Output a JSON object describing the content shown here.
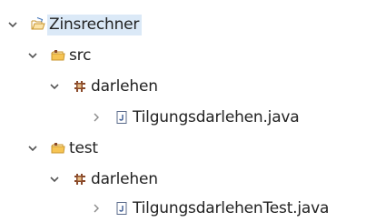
{
  "tree": {
    "project": {
      "label": "Zinsrechner",
      "expanded": true,
      "selected": true,
      "icon": "project-folder-icon"
    },
    "src_folder": {
      "label": "src",
      "expanded": true,
      "icon": "source-folder-icon"
    },
    "src_package": {
      "label": "darlehen",
      "expanded": true,
      "icon": "package-icon"
    },
    "src_file": {
      "label": "Tilgungsdarlehen.java",
      "expanded": false,
      "icon": "java-file-icon"
    },
    "test_folder": {
      "label": "test",
      "expanded": true,
      "icon": "source-folder-icon"
    },
    "test_package": {
      "label": "darlehen",
      "expanded": true,
      "icon": "package-icon"
    },
    "test_file": {
      "label": "TilgungsdarlehenTest.java",
      "expanded": false,
      "icon": "java-file-icon"
    }
  },
  "colors": {
    "selection": "#dbe9f7",
    "folder": "#e8b03a",
    "package": "#8a4a2a",
    "twisty": "#555555",
    "file_border": "#5a6a8a"
  }
}
